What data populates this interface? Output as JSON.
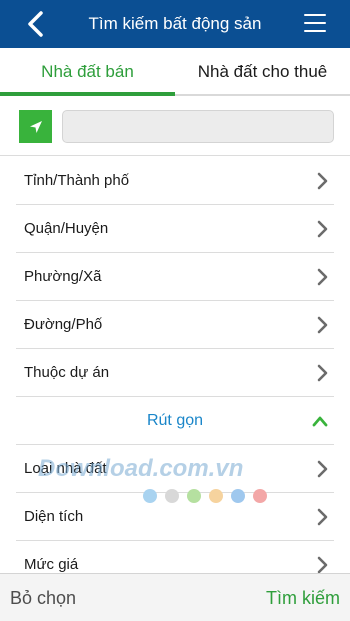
{
  "header": {
    "title": "Tìm kiếm bất động sản",
    "back_icon": "chevron-left-icon",
    "menu_icon": "hamburger-menu-icon",
    "color": "#0b4f93"
  },
  "tabs": [
    {
      "label": "Nhà đất bán",
      "active": true
    },
    {
      "label": "Nhà đất cho thuê",
      "active": false
    }
  ],
  "location": {
    "button_icon": "location-arrow-icon",
    "button_color": "#39b33c",
    "input_value": "",
    "input_placeholder": ""
  },
  "filters_top": [
    {
      "label": "Tỉnh/Thành phố"
    },
    {
      "label": "Quận/Huyện"
    },
    {
      "label": "Phường/Xã"
    },
    {
      "label": "Đường/Phố"
    },
    {
      "label": "Thuộc dự án"
    }
  ],
  "collapse": {
    "label": "Rút gọn",
    "icon": "chevron-up-icon",
    "color": "#1a86c9"
  },
  "filters_bottom": [
    {
      "label": "Loại nhà đất"
    },
    {
      "label": "Diện tích"
    },
    {
      "label": "Mức giá"
    }
  ],
  "watermark": {
    "text": "Download.com.vn",
    "dot_colors": [
      "#a9d3f0",
      "#d8d8d8",
      "#b5e0a0",
      "#f6d39e",
      "#9fc8ee",
      "#f3a7a7"
    ]
  },
  "footer": {
    "clear_label": "Bỏ chọn",
    "search_label": "Tìm kiếm",
    "accent": "#2e9e3b"
  }
}
